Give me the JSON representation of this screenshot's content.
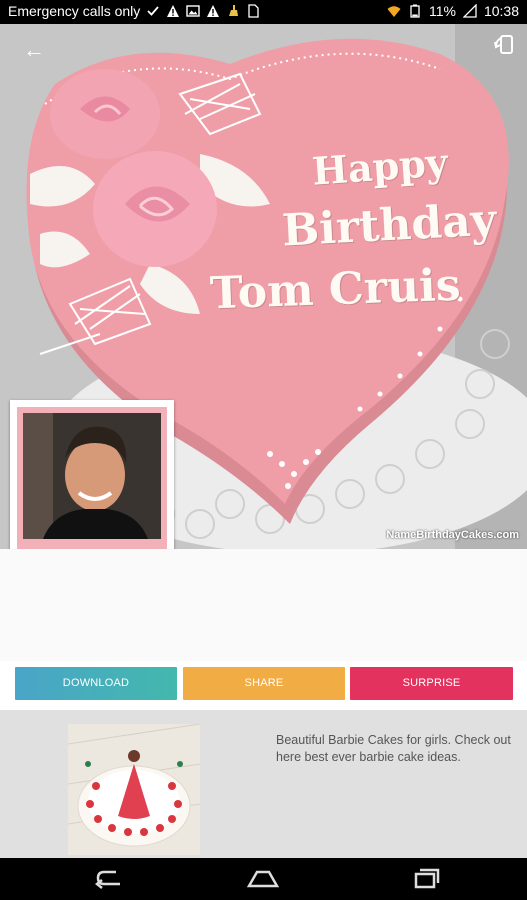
{
  "status_bar": {
    "carrier_text": "Emergency calls only",
    "battery": "11%",
    "time": "10:38"
  },
  "hero": {
    "cake_line1": "Happy",
    "cake_line2": "Birthday",
    "cake_line3": "Tom Cruis",
    "watermark": "NameBirthdayCakes.com"
  },
  "actions": {
    "download": "DOWNLOAD",
    "share": "SHARE",
    "surprise": "SURPRISE"
  },
  "ad": {
    "description": "Beautiful Barbie Cakes for girls. Check out here best ever barbie cake ideas."
  },
  "colors": {
    "download": "#43b8ad",
    "share": "#f1ac44",
    "surprise": "#e3325e",
    "cake_pink": "#ef9ea7"
  }
}
